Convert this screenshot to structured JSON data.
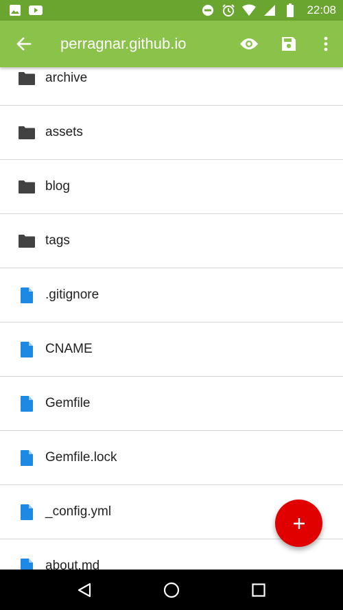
{
  "status_bar": {
    "time": "22:08",
    "left_icons": [
      "image-icon",
      "youtube-icon"
    ],
    "right_icons": [
      "do-not-disturb-icon",
      "alarm-icon",
      "wifi-icon",
      "signal-icon",
      "battery-icon"
    ]
  },
  "app_bar": {
    "title": "perragnar.github.io",
    "actions": [
      "eye-icon",
      "save-icon",
      "more-vert-icon"
    ]
  },
  "files": [
    {
      "name": "archive",
      "type": "folder"
    },
    {
      "name": "assets",
      "type": "folder"
    },
    {
      "name": "blog",
      "type": "folder"
    },
    {
      "name": "tags",
      "type": "folder"
    },
    {
      "name": ".gitignore",
      "type": "file"
    },
    {
      "name": "CNAME",
      "type": "file"
    },
    {
      "name": "Gemfile",
      "type": "file"
    },
    {
      "name": "Gemfile.lock",
      "type": "file"
    },
    {
      "name": "_config.yml",
      "type": "file"
    },
    {
      "name": "about.md",
      "type": "file"
    }
  ],
  "fab": {
    "icon": "plus-icon"
  },
  "colors": {
    "status_bar": "#6aa52f",
    "app_bar": "#8bc34a",
    "folder_icon": "#424242",
    "file_icon": "#1e88e5",
    "fab": "#e00000"
  }
}
